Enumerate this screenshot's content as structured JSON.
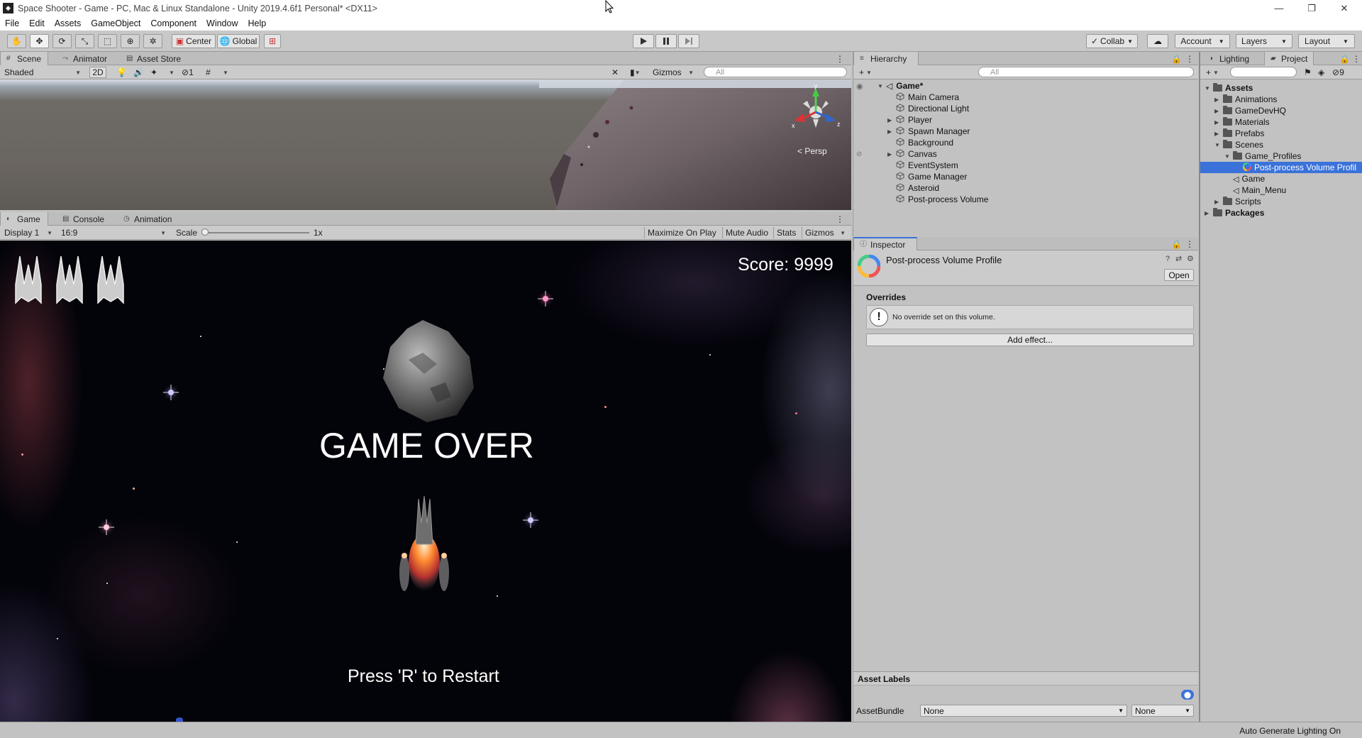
{
  "window": {
    "title": "Space Shooter - Game - PC, Mac & Linux Standalone - Unity 2019.4.6f1 Personal* <DX11>"
  },
  "menu": [
    "File",
    "Edit",
    "Assets",
    "GameObject",
    "Component",
    "Window",
    "Help"
  ],
  "toolbar": {
    "center_label": "Center",
    "global_label": "Global",
    "collab_label": "Collab",
    "account_label": "Account",
    "layers_label": "Layers",
    "layout_label": "Layout"
  },
  "scene_panel": {
    "tabs": [
      "Scene",
      "Animator",
      "Asset Store"
    ],
    "shading_mode": "Shaded",
    "two_d_label": "2D",
    "hidden_count": "1",
    "gizmos_label": "Gizmos",
    "search_placeholder": "All",
    "persp_label": "< Persp",
    "axis_x": "x",
    "axis_y": "y",
    "axis_z": "z"
  },
  "game_panel": {
    "tabs": [
      "Game",
      "Console",
      "Animation"
    ],
    "display": "Display 1",
    "aspect": "16:9",
    "scale_label": "Scale",
    "scale_value": "1x",
    "toggles": [
      "Maximize On Play",
      "Mute Audio",
      "Stats",
      "Gizmos"
    ],
    "score_text": "Score: 9999",
    "game_over_text": "GAME OVER",
    "restart_text": "Press 'R' to Restart"
  },
  "hierarchy": {
    "tab": "Hierarchy",
    "search_placeholder": "All",
    "scene_name": "Game*",
    "items": [
      {
        "label": "Main Camera",
        "expandable": false
      },
      {
        "label": "Directional Light",
        "expandable": false
      },
      {
        "label": "Player",
        "expandable": true
      },
      {
        "label": "Spawn Manager",
        "expandable": true
      },
      {
        "label": "Background",
        "expandable": false
      },
      {
        "label": "Canvas",
        "expandable": true
      },
      {
        "label": "EventSystem",
        "expandable": false
      },
      {
        "label": "Game Manager",
        "expandable": false
      },
      {
        "label": "Asteroid",
        "expandable": false
      },
      {
        "label": "Post-process Volume",
        "expandable": false
      }
    ]
  },
  "project": {
    "tabs": [
      "Lighting",
      "Project"
    ],
    "hidden_count": "9",
    "tree": [
      {
        "label": "Assets",
        "depth": 0,
        "type": "folder",
        "bold": true,
        "open": true
      },
      {
        "label": "Animations",
        "depth": 1,
        "type": "folder"
      },
      {
        "label": "GameDevHQ",
        "depth": 1,
        "type": "folder"
      },
      {
        "label": "Materials",
        "depth": 1,
        "type": "folder"
      },
      {
        "label": "Prefabs",
        "depth": 1,
        "type": "folder"
      },
      {
        "label": "Scenes",
        "depth": 1,
        "type": "folder",
        "open": true
      },
      {
        "label": "Game_Profiles",
        "depth": 2,
        "type": "folder",
        "open": true
      },
      {
        "label": "Post-process Volume Profil",
        "depth": 3,
        "type": "profile",
        "selected": true
      },
      {
        "label": "Game",
        "depth": 2,
        "type": "scene"
      },
      {
        "label": "Main_Menu",
        "depth": 2,
        "type": "scene"
      },
      {
        "label": "Scripts",
        "depth": 1,
        "type": "folder"
      },
      {
        "label": "Packages",
        "depth": 0,
        "type": "folder",
        "bold": true
      }
    ]
  },
  "inspector": {
    "tab": "Inspector",
    "asset_name": "Post-process Volume Profile",
    "open_button": "Open",
    "overrides_title": "Overrides",
    "no_override_text": "No override set on this volume.",
    "add_effect_button": "Add effect...",
    "asset_labels_title": "Asset Labels",
    "assetbundle_label": "AssetBundle",
    "assetbundle_value": "None",
    "variant_value": "None"
  },
  "status_bar": {
    "text": "Auto Generate Lighting On"
  },
  "colors": {
    "accent_blue": "#3a72d9",
    "selection": "#3a72d9",
    "panel_bg": "#c2c2c2"
  }
}
